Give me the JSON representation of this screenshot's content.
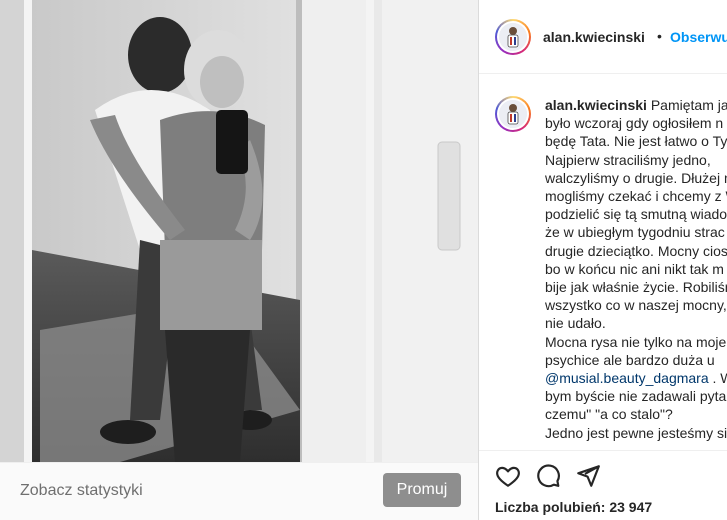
{
  "post": {
    "username": "alan.kwiecinski",
    "separator": "•",
    "follow_label": "Obserwuj"
  },
  "caption": {
    "username": "alan.kwiecinski",
    "lines": [
      "Pamiętam jak",
      "było wczoraj gdy ogłosiłem n",
      "będę Tata. Nie jest łatwo o Ty",
      "Najpierw straciliśmy jedno,",
      "walczyliśmy o drugie. Dłużej n",
      "mogliśmy czekać i chcemy z W",
      "podzielić się tą smutną wiado",
      "że w ubiegłym tygodniu strac",
      "drugie dzieciątko. Mocny cios",
      "bo w końcu nic ani nikt tak m",
      "bije jak właśnie życie. Robiliśn",
      "wszystko co w naszej mocny,",
      "nie udało.",
      "Mocna rysa nie tylko na moje",
      "psychice ale bardzo duża u",
      "bym byście nie zadawali pytar",
      "czemu\" \"a co stalo\"?",
      "Jedno jest pewne jesteśmy sil"
    ],
    "mention": "@musial.beauty_dagmara",
    "mention_suffix": " . W"
  },
  "stats": {
    "link_label": "Zobacz statystyki",
    "promote_label": "Promuj"
  },
  "actions": {
    "like_icon": "heart-icon",
    "comment_icon": "comment-icon",
    "share_icon": "share-icon",
    "likes_label": "Liczba polubień:",
    "likes_count": "23 947"
  },
  "colors": {
    "link_blue": "#0095f6",
    "mention": "#00376b",
    "promote_button": "#8e8e8e"
  }
}
